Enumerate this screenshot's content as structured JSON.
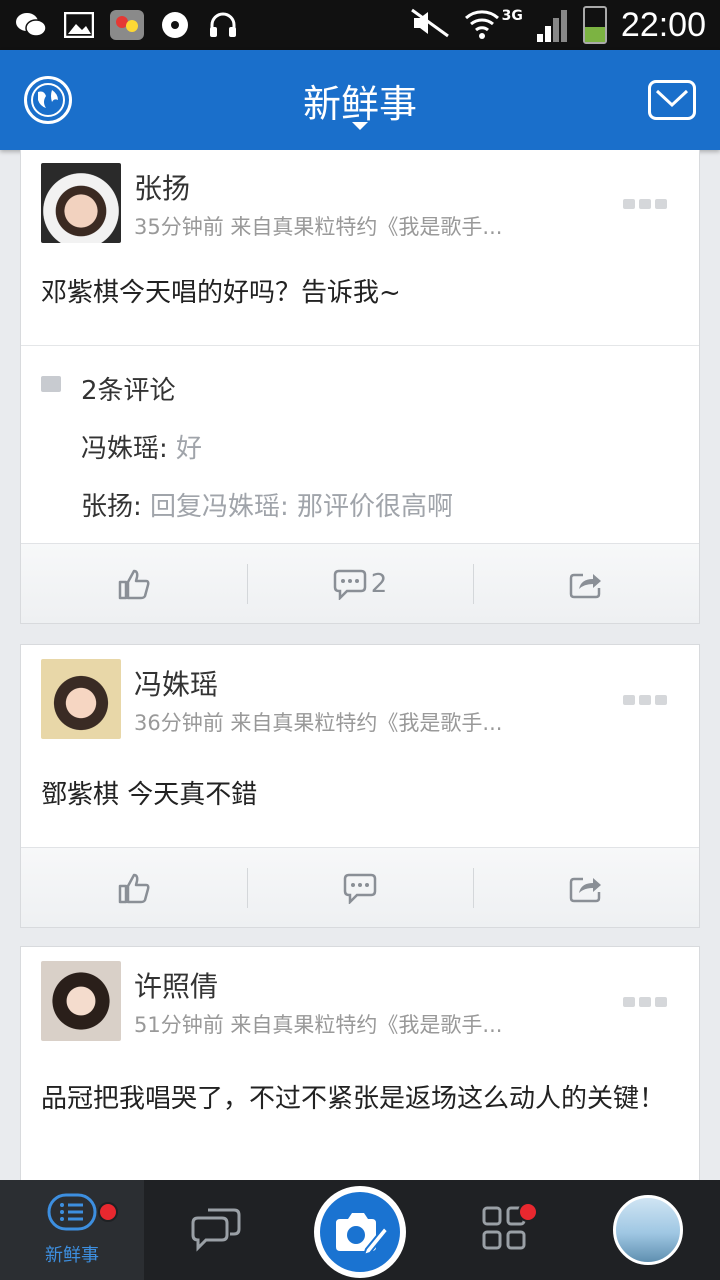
{
  "status_bar": {
    "time": "22:00",
    "network": "3G",
    "icons": [
      "wechat-icon",
      "image-icon",
      "woo-app-icon",
      "music-icon",
      "headphones-icon",
      "mute-icon",
      "wifi-icon",
      "signal-icon",
      "battery-icon"
    ]
  },
  "header": {
    "title": "新鲜事",
    "left_icon": "globe-icon",
    "right_icon": "mail-icon"
  },
  "posts": [
    {
      "author": "张扬",
      "meta": "35分钟前 来自真果粒特约《我是歌手...",
      "text": "邓紫棋今天唱的好吗？告诉我~",
      "comments": {
        "count_label": "2条评论",
        "items": [
          {
            "author": "冯姝瑶:",
            "text": " 好"
          },
          {
            "author": "张扬:",
            "text": " 回复冯姝瑶: 那评价很高啊"
          }
        ]
      },
      "actions": {
        "comment_count": "2"
      }
    },
    {
      "author": "冯姝瑶",
      "meta": "36分钟前 来自真果粒特约《我是歌手...",
      "text": "鄧紫棋  今天真不錯",
      "actions": {
        "comment_count": ""
      }
    },
    {
      "author": "许照倩",
      "meta": "51分钟前 来自真果粒特约《我是歌手...",
      "text": "品冠把我唱哭了，不过不紧张是返场这么动人的关键！"
    }
  ],
  "tabbar": {
    "items": [
      {
        "label": "新鲜事",
        "icon": "feed-list-icon",
        "badge": true,
        "active": true
      },
      {
        "label": "",
        "icon": "chat-bubbles-icon",
        "badge": false
      },
      {
        "label": "",
        "icon": "camera-edit-icon",
        "badge": false
      },
      {
        "label": "",
        "icon": "apps-grid-icon",
        "badge": true
      },
      {
        "label": "",
        "icon": "profile-avatar",
        "badge": false
      }
    ]
  },
  "colors": {
    "header_blue": "#1a6fcb",
    "accent_blue": "#3d8fe0",
    "badge_red": "#e8282f"
  }
}
